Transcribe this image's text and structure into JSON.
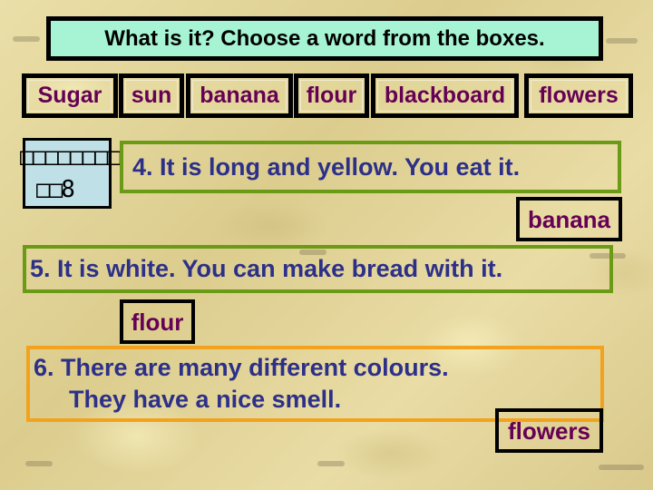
{
  "title": "What is it? Choose a word from the boxes.",
  "word_bank": [
    "Sugar",
    "sun",
    "banana",
    "flour",
    "blackboard",
    "flowers"
  ],
  "garbled_label": {
    "line1": "□□□□□□□□",
    "line2": "□□8"
  },
  "questions": [
    {
      "number": "4.",
      "lines": [
        "4.  It is long and yellow.  You eat it."
      ],
      "answer": "banana",
      "border_color": "#6b9a17"
    },
    {
      "number": "5.",
      "lines": [
        "5.  It is white.  You can make bread with it."
      ],
      "answer": "flour",
      "border_color": "#6b9a17"
    },
    {
      "number": "6.",
      "lines": [
        "6. There are many different colours.",
        "They have a nice smell."
      ],
      "answer": "flowers",
      "border_color": "#f2a21c"
    }
  ],
  "colors": {
    "title_fill": "#a6f4d4",
    "question_text": "#2d3089",
    "word_text": "#660055",
    "garble_fill": "#bfe0e6"
  }
}
